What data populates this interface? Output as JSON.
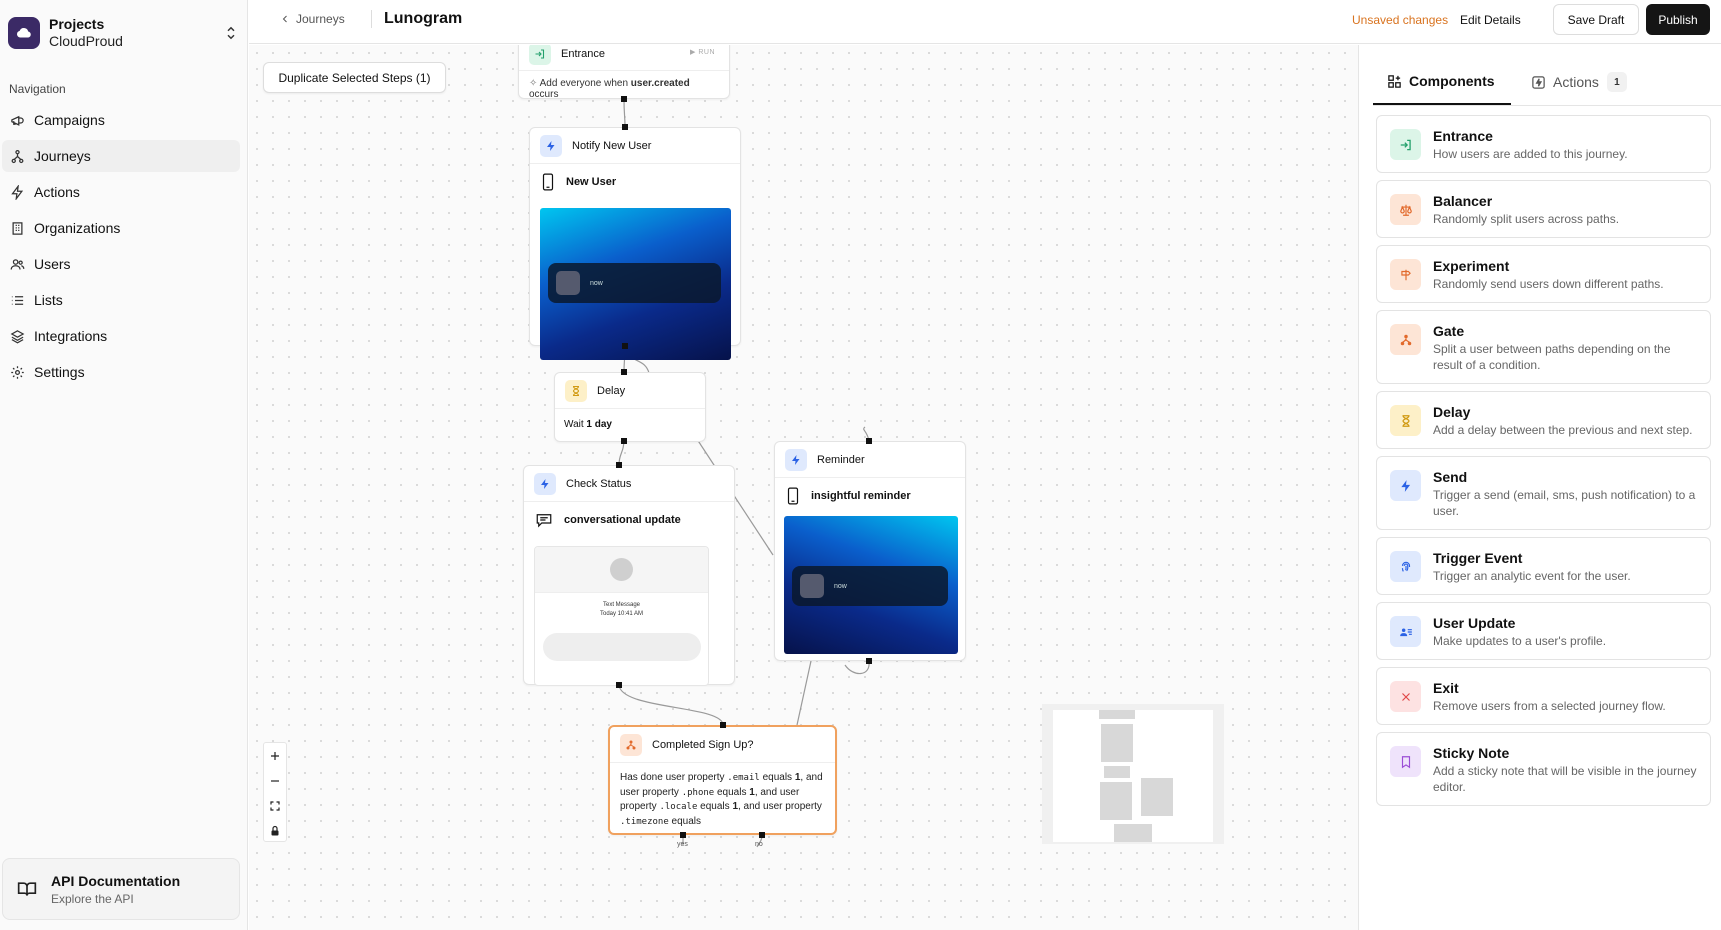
{
  "sidebar": {
    "project_name": "Projects",
    "project_org": "CloudProud",
    "nav_heading": "Navigation",
    "items": [
      {
        "label": "Campaigns",
        "icon": "megaphone-icon"
      },
      {
        "label": "Journeys",
        "icon": "journey-icon",
        "active": true
      },
      {
        "label": "Actions",
        "icon": "bolt-icon"
      },
      {
        "label": "Organizations",
        "icon": "building-icon"
      },
      {
        "label": "Users",
        "icon": "users-icon"
      },
      {
        "label": "Lists",
        "icon": "list-icon"
      },
      {
        "label": "Integrations",
        "icon": "layers-icon"
      },
      {
        "label": "Settings",
        "icon": "gear-icon"
      }
    ],
    "api_title": "API Documentation",
    "api_sub": "Explore the API"
  },
  "topbar": {
    "breadcrumb": "Journeys",
    "title": "Lunogram",
    "unsaved": "Unsaved changes",
    "edit_details": "Edit Details",
    "save_draft": "Save Draft",
    "publish": "Publish"
  },
  "canvas": {
    "duplicate_button": "Duplicate Selected Steps (1)",
    "nodes": {
      "entrance": {
        "title": "Entrance",
        "tag": "RUN",
        "desc_pre": "Add everyone when ",
        "desc_event": "user.created",
        "desc_post": " occurs"
      },
      "notify": {
        "title": "Notify New User",
        "template": "New User",
        "push_time": "now"
      },
      "delay": {
        "title": "Delay",
        "wait_pre": "Wait ",
        "wait_value": "1 day"
      },
      "check": {
        "title": "Check Status",
        "template": "conversational update",
        "sms_label": "Text Message",
        "sms_time": "Today 10:41 AM"
      },
      "reminder": {
        "title": "Reminder",
        "template": "insightful reminder",
        "push_time": "now"
      },
      "gate": {
        "title": "Completed Sign Up?",
        "t1": "Has done user property ",
        "p1": ".email",
        "t2": " equals ",
        "v1": "1",
        "t3": ", and user property ",
        "p2": ".phone",
        "t4": " equals ",
        "v2": "1",
        "t5": ", and user property ",
        "p3": ".locale",
        "t6": " equals ",
        "v3": "1",
        "t7": ", and user property ",
        "p4": ".timezone",
        "t8": " equals",
        "yes_label": "yes",
        "no_label": "no"
      }
    }
  },
  "panel": {
    "tab_components": "Components",
    "tab_actions": "Actions",
    "actions_count": "1",
    "components": [
      {
        "title": "Entrance",
        "desc": "How users are added to this journey.",
        "color": "green",
        "icon": "enter-icon"
      },
      {
        "title": "Balancer",
        "desc": "Randomly split users across paths.",
        "color": "orange",
        "icon": "scale-icon"
      },
      {
        "title": "Experiment",
        "desc": "Randomly send users down different paths.",
        "color": "orange",
        "icon": "signpost-icon"
      },
      {
        "title": "Gate",
        "desc": "Split a user between paths depending on the result of a condition.",
        "color": "orange",
        "icon": "split-icon"
      },
      {
        "title": "Delay",
        "desc": "Add a delay between the previous and next step.",
        "color": "yellow",
        "icon": "hourglass-icon"
      },
      {
        "title": "Send",
        "desc": "Trigger a send (email, sms, push notification) to a user.",
        "color": "blue",
        "icon": "bolt-icon"
      },
      {
        "title": "Trigger Event",
        "desc": "Trigger an analytic event for the user.",
        "color": "blue",
        "icon": "fingerprint-icon"
      },
      {
        "title": "User Update",
        "desc": "Make updates to a user's profile.",
        "color": "blue",
        "icon": "user-card-icon"
      },
      {
        "title": "Exit",
        "desc": "Remove users from a selected journey flow.",
        "color": "red",
        "icon": "x-icon"
      },
      {
        "title": "Sticky Note",
        "desc": "Add a sticky note that will be visible in the journey editor.",
        "color": "purple",
        "icon": "bookmark-icon"
      }
    ]
  },
  "colors": {
    "accent": "#151515",
    "unsaved": "#d9731f",
    "gate_border": "#f0a15e",
    "brand": "#3b2a66"
  }
}
